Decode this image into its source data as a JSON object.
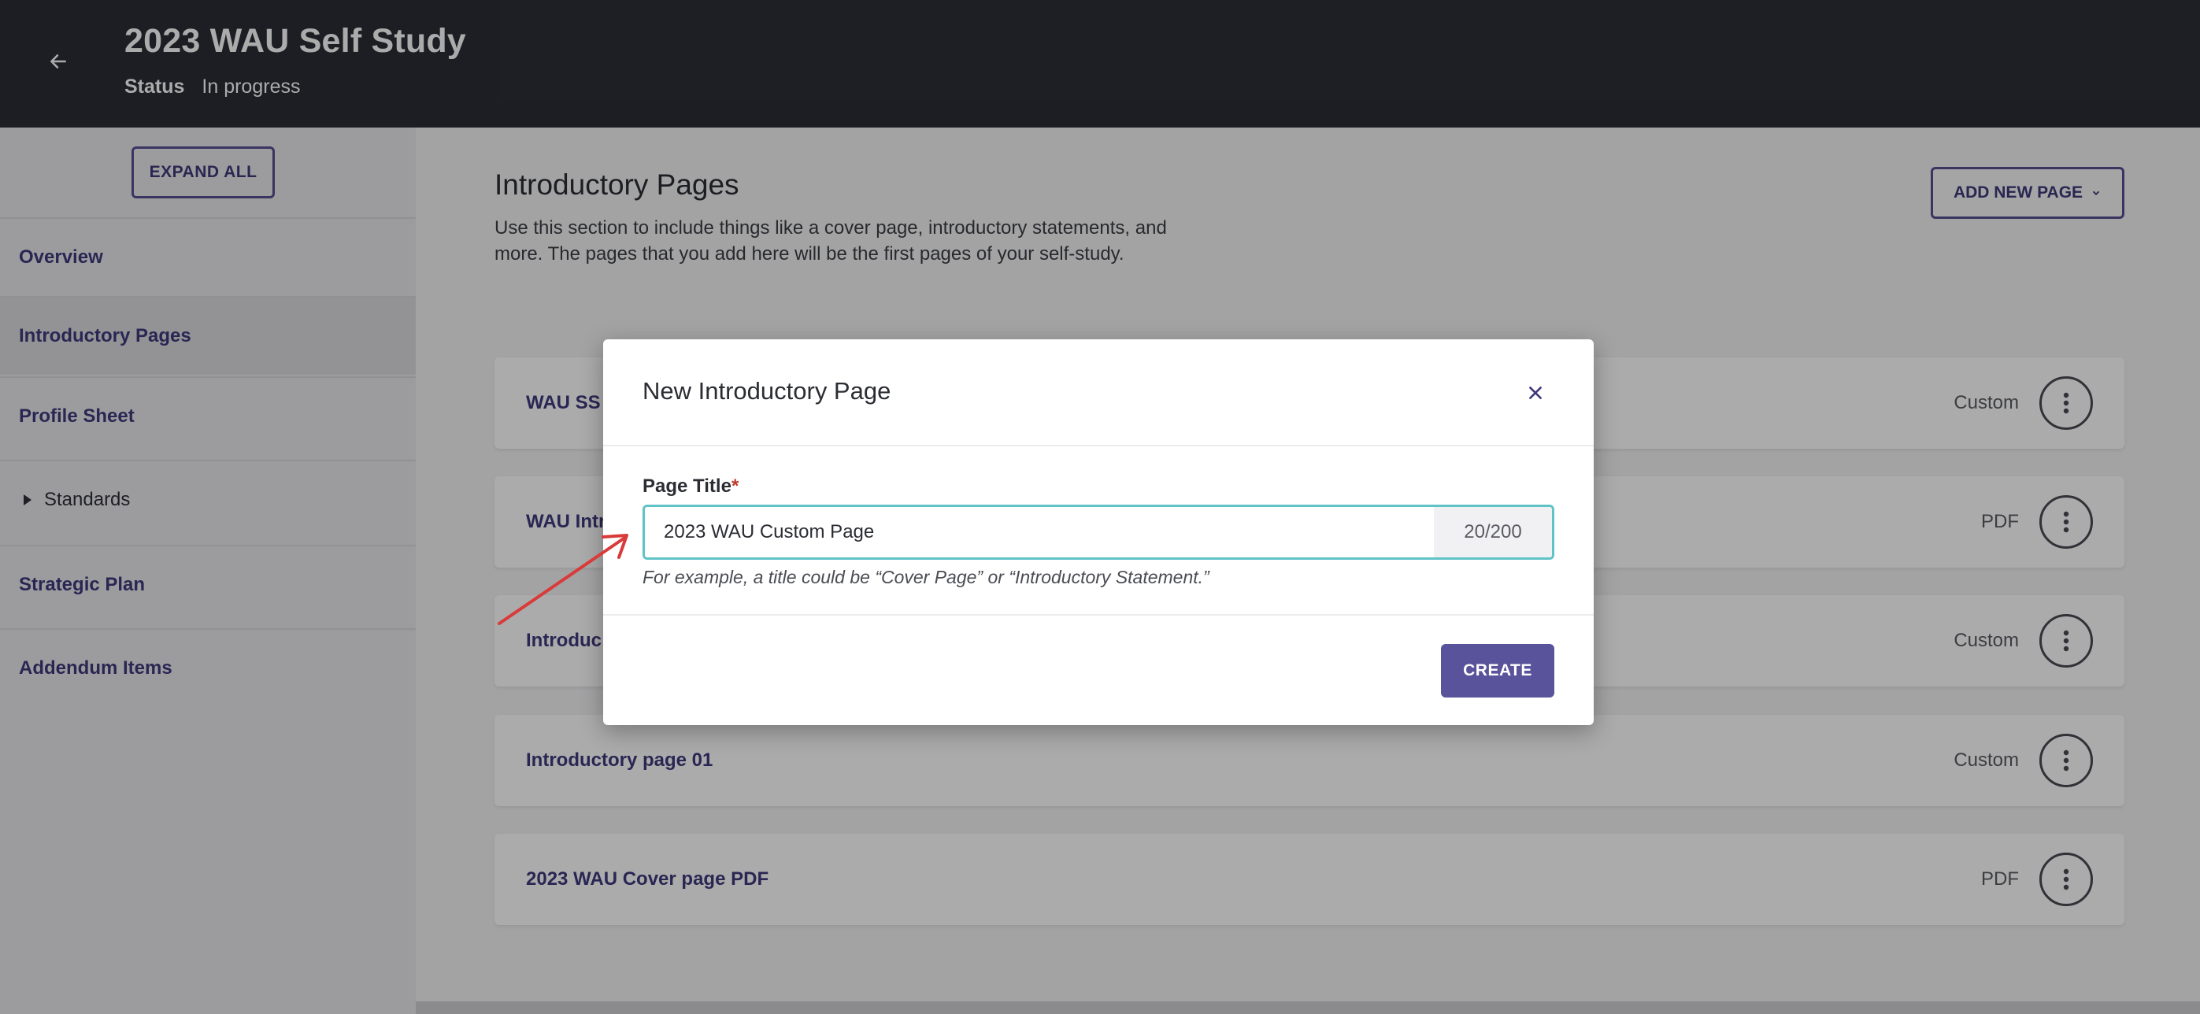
{
  "header": {
    "title": "2023 WAU Self Study",
    "status_label": "Status",
    "status_value": "In progress"
  },
  "sidebar": {
    "expand_all": "EXPAND ALL",
    "items": [
      {
        "label": "Overview"
      },
      {
        "label": "Introductory Pages"
      },
      {
        "label": "Profile Sheet"
      },
      {
        "label": "Standards"
      },
      {
        "label": "Strategic Plan"
      },
      {
        "label": "Addendum Items"
      }
    ]
  },
  "main": {
    "heading": "Introductory Pages",
    "description": "Use this section to include things like a cover page, introductory statements, and more. The pages that you add here will be the first pages of your self-study.",
    "add_button": "ADD NEW PAGE",
    "pages": [
      {
        "title": "WAU SS",
        "type": "Custom"
      },
      {
        "title": "WAU Intr",
        "type": "PDF"
      },
      {
        "title": "Introduc",
        "type": "Custom"
      },
      {
        "title": "Introductory page 01",
        "type": "Custom"
      },
      {
        "title": "2023 WAU Cover page PDF",
        "type": "PDF"
      }
    ]
  },
  "modal": {
    "title": "New Introductory Page",
    "field_label": "Page Title",
    "required_mark": "*",
    "input_value": "2023 WAU Custom Page",
    "counter": "20/200",
    "helper": "For example, a title could be “Cover Page” or “Introductory Statement.”",
    "create_button": "CREATE"
  },
  "colors": {
    "header_bg": "#2b2e37",
    "accent": "#58539a",
    "input_focus": "#5fc3c7",
    "annotation": "#d93a3a"
  }
}
